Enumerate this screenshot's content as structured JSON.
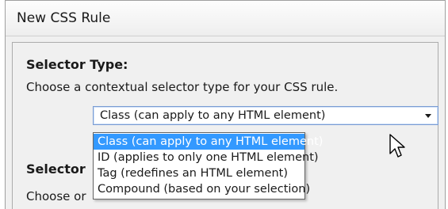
{
  "dialog": {
    "title": "New CSS Rule"
  },
  "selector_type": {
    "heading": "Selector Type:",
    "description": "Choose a contextual selector type for your CSS rule.",
    "selected_value": "Class (can apply to any HTML element)",
    "options": [
      "Class (can apply to any HTML element)",
      "ID (applies to only one HTML element)",
      "Tag (redefines an HTML element)",
      "Compound (based on your selection)"
    ],
    "highlighted_index": 0
  },
  "selector_name": {
    "heading_partial": "Selector",
    "description_partial": "Choose or"
  },
  "colors": {
    "highlight": "#3399ff",
    "dialog_bg": "#f0f0f0"
  },
  "icons": {
    "cursor": "mouse-pointer-icon",
    "dropdown": "chevron-down-icon"
  }
}
